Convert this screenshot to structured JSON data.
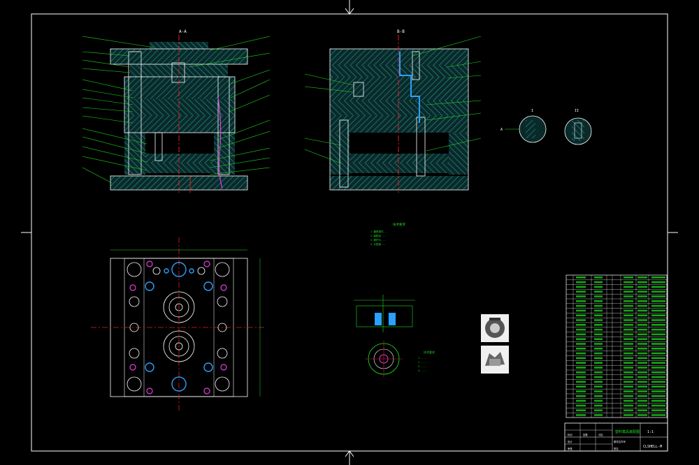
{
  "sheet": {
    "background": "#000000",
    "colors": {
      "frame": "#ffffff",
      "hatch": "#2a9a9a",
      "plate": "#1f8f8f",
      "leader": "#1ee01e",
      "centerline": "#e02020",
      "cooling": "#e040e0",
      "screw": "#2aa0ff",
      "table_line": "#ffffff",
      "table_text": "#1ee01e"
    }
  },
  "views": {
    "section_a_label": "A-A",
    "section_b_label": "B-B",
    "detail_1_label": "I",
    "detail_2_label": "II",
    "detail_arrow_label": "A"
  },
  "notes": {
    "title": "技术要求",
    "lines": [
      "1.模具零件...",
      "2.装配后...",
      "3.推杆与...",
      "4.分型面..."
    ]
  },
  "part_notes": {
    "title": "技术要求",
    "lines": [
      "1.....",
      "2.....",
      "3.....",
      "4....."
    ]
  },
  "title_block": {
    "drawing_name": "塑料模具装配图",
    "scale": "1:1",
    "drawing_no": "CLSHELL-M",
    "sheet_marks": [
      "标记",
      "处数",
      "分区",
      "更改文件号",
      "签名",
      "年月日"
    ],
    "row_marks": [
      "设计",
      "审核",
      "工艺",
      "批准"
    ]
  },
  "bom": {
    "rows": 30
  },
  "icons": {
    "thumb1": "gear-part-thumbnail-icon",
    "thumb2": "gear-part-3d-icon"
  }
}
